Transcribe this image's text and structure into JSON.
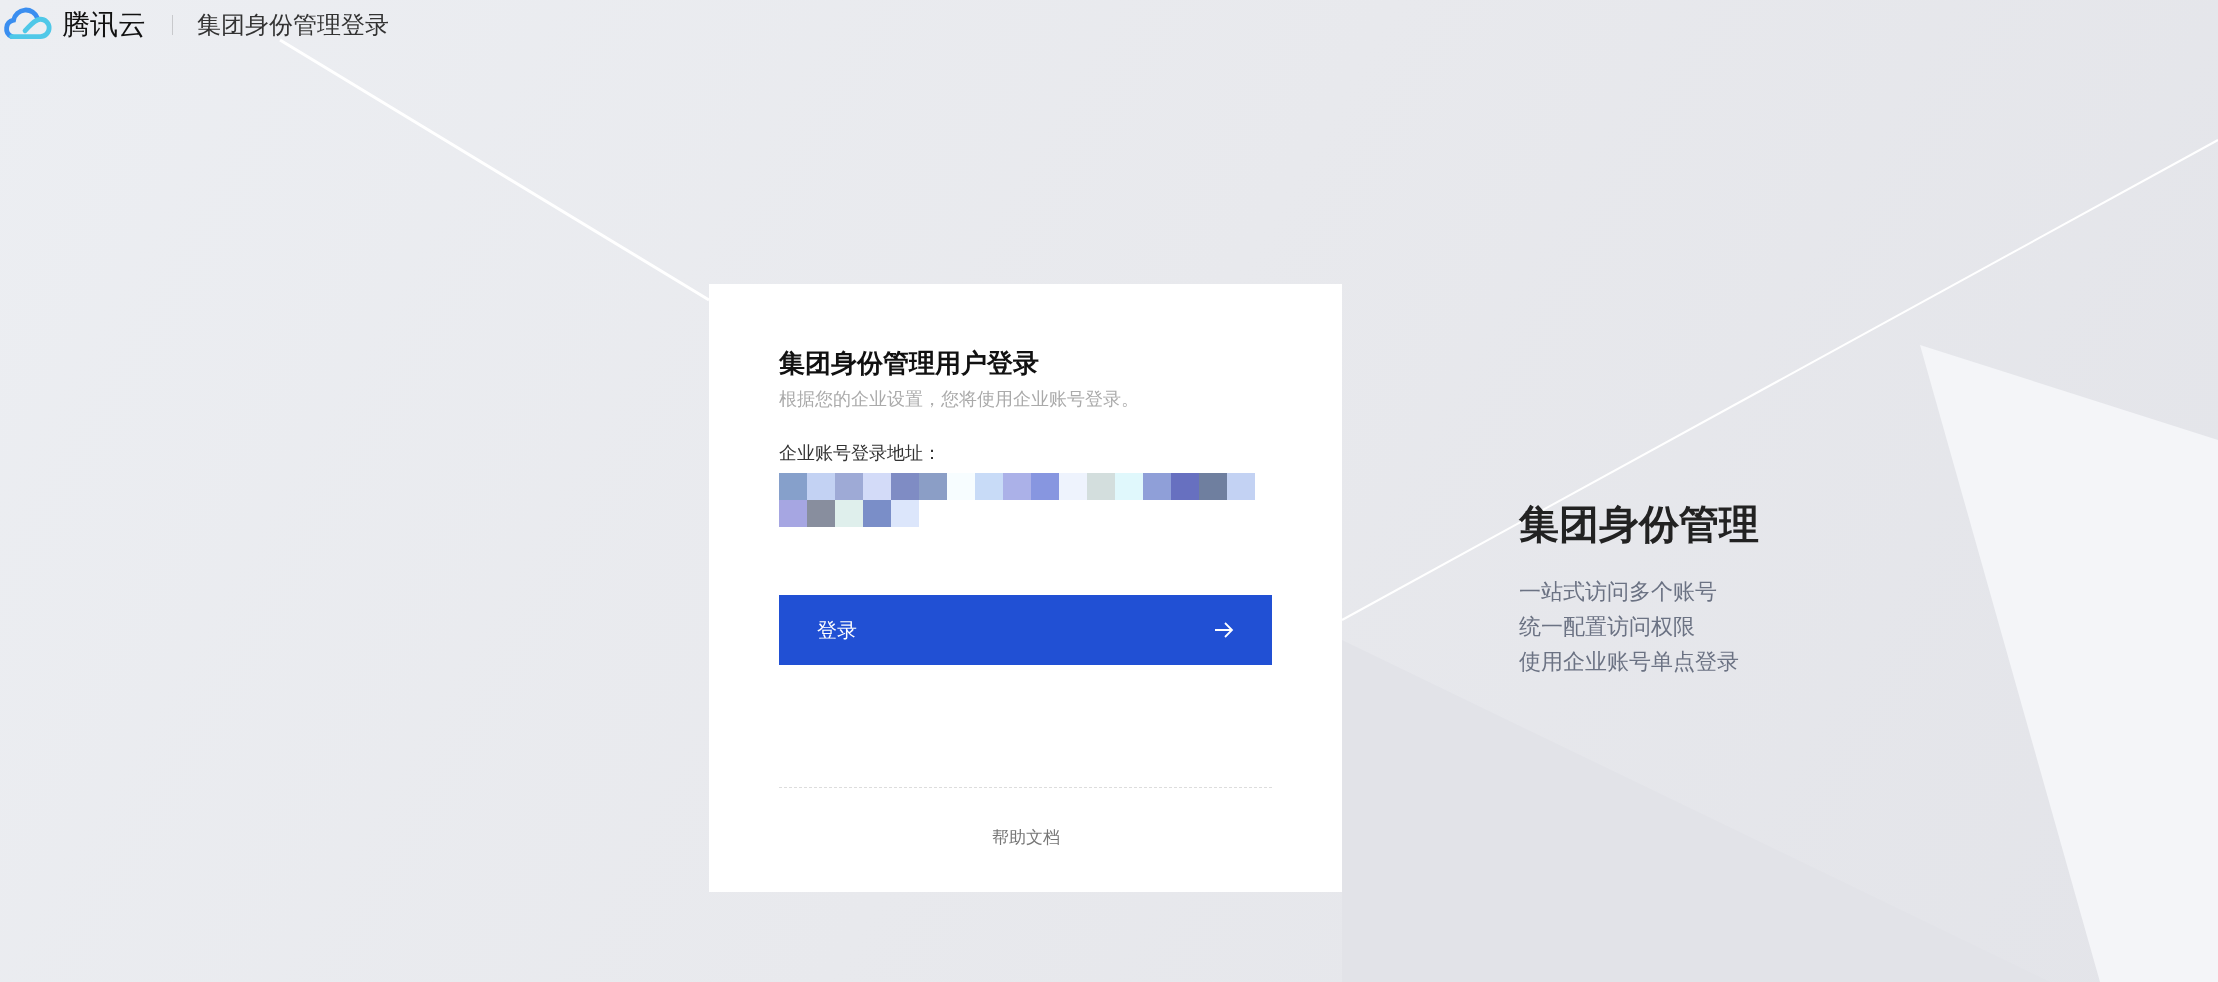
{
  "header": {
    "brand": "腾讯云",
    "title": "集团身份管理登录"
  },
  "login_card": {
    "title": "集团身份管理用户登录",
    "subtitle": "根据您的企业设置，您将使用企业账号登录。",
    "address_label": "企业账号登录地址：",
    "button": "登录",
    "help_link": "帮助文档"
  },
  "intro": {
    "title": "集团身份管理",
    "features": [
      "一站式访问多个账号",
      "统一配置访问权限",
      "使用企业账号单点登录"
    ]
  }
}
